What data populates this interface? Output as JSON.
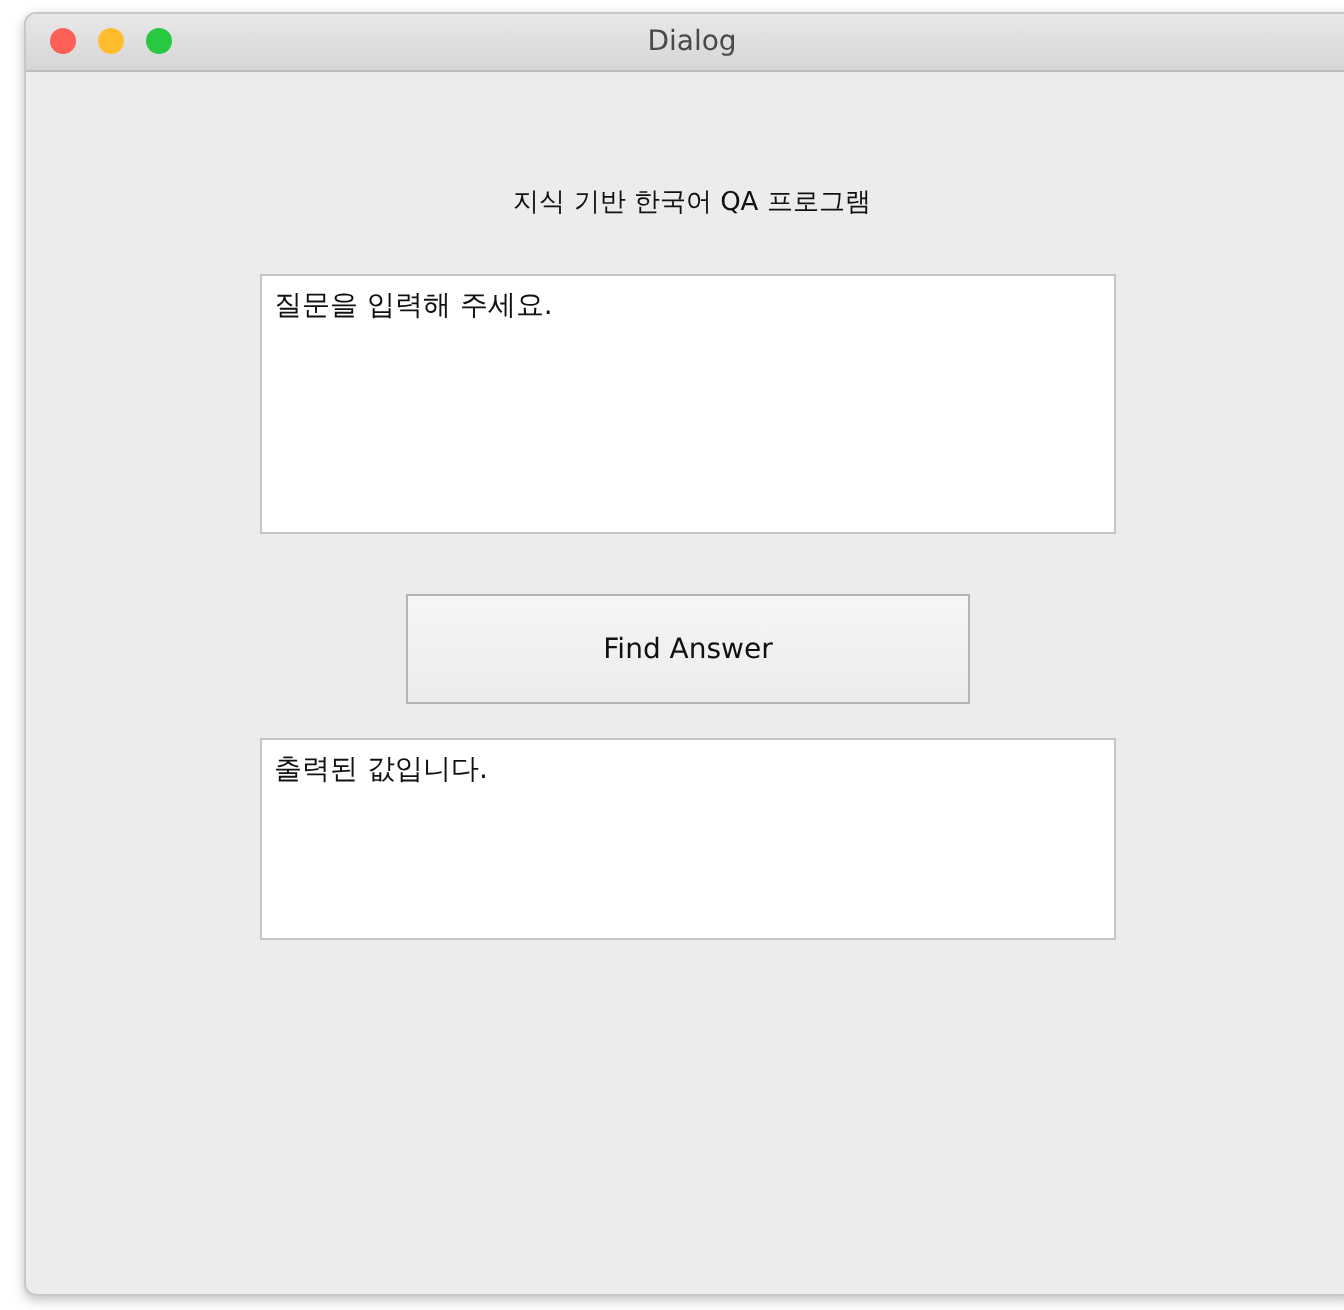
{
  "window": {
    "title": "Dialog"
  },
  "heading": "지식 기반 한국어 QA 프로그램",
  "question_field": {
    "value": "질문을 입력해 주세요."
  },
  "find_button": {
    "label": "Find Answer"
  },
  "answer_field": {
    "value": "출력된 값입니다."
  }
}
